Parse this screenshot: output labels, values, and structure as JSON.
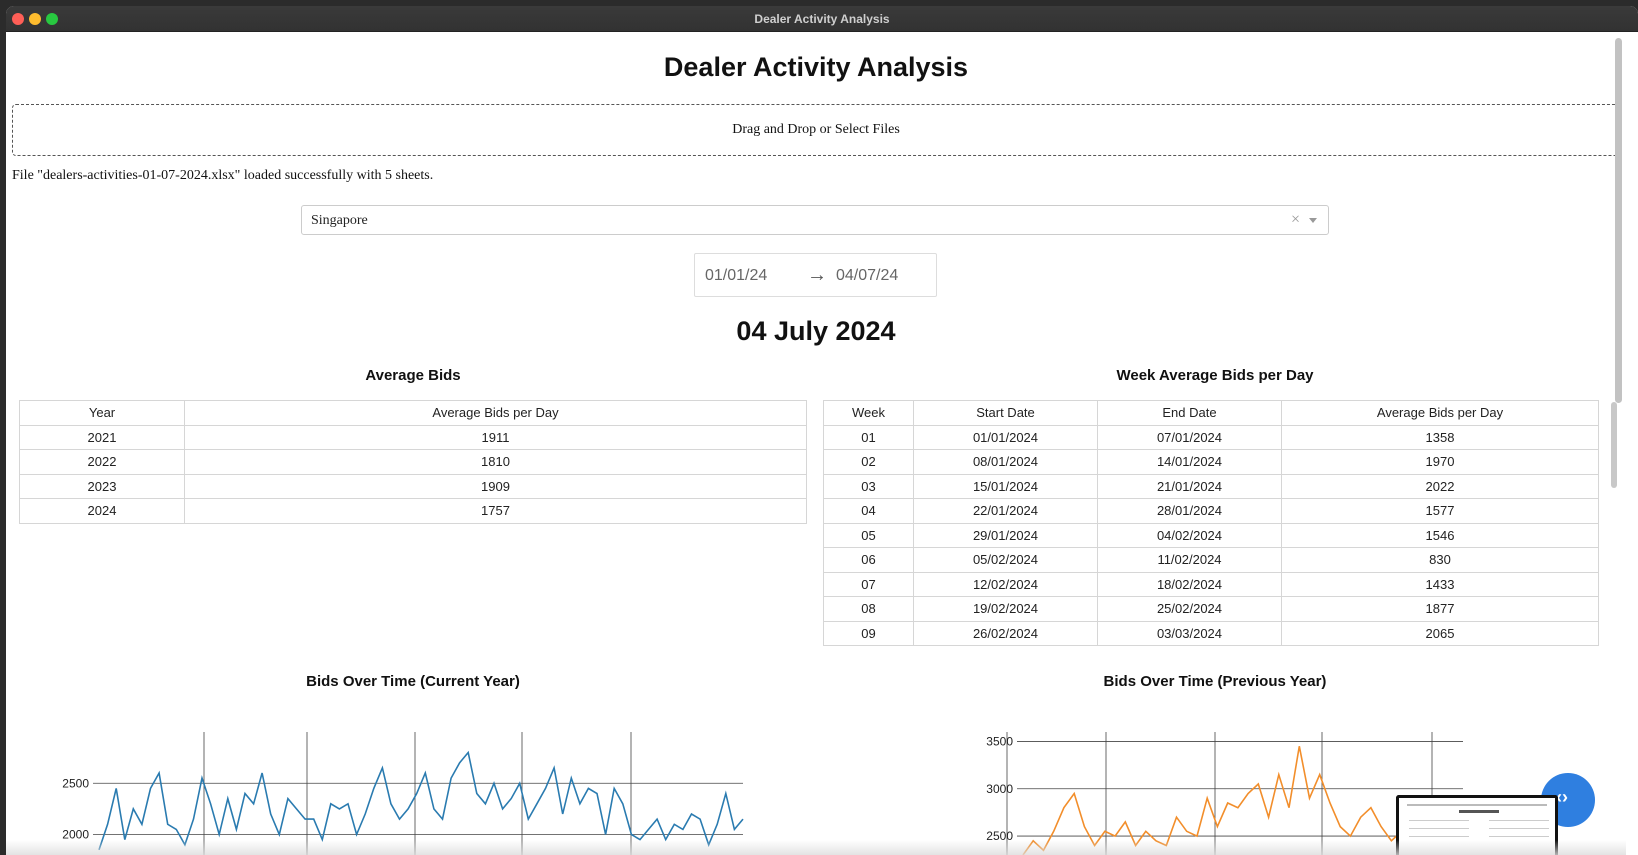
{
  "window": {
    "title": "Dealer Activity Analysis"
  },
  "page": {
    "title": "Dealer Activity Analysis"
  },
  "upload": {
    "label": "Drag and Drop or Select Files"
  },
  "file_message": "File \"dealers-activities-01-07-2024.xlsx\" loaded successfully with 5 sheets.",
  "country_select": {
    "value": "Singapore",
    "clear": "×"
  },
  "date_range": {
    "start": "01/01/24",
    "arrow": "→",
    "end": "04/07/24"
  },
  "selected_date": "04 July 2024",
  "avg_bids": {
    "title": "Average Bids",
    "headers": [
      "Year",
      "Average Bids per Day"
    ],
    "rows": [
      [
        "2021",
        "1911"
      ],
      [
        "2022",
        "1810"
      ],
      [
        "2023",
        "1909"
      ],
      [
        "2024",
        "1757"
      ]
    ]
  },
  "week_avg": {
    "title": "Week Average Bids per Day",
    "headers": [
      "Week",
      "Start Date",
      "End Date",
      "Average Bids per Day"
    ],
    "rows": [
      [
        "01",
        "01/01/2024",
        "07/01/2024",
        "1358"
      ],
      [
        "02",
        "08/01/2024",
        "14/01/2024",
        "1970"
      ],
      [
        "03",
        "15/01/2024",
        "21/01/2024",
        "2022"
      ],
      [
        "04",
        "22/01/2024",
        "28/01/2024",
        "1577"
      ],
      [
        "05",
        "29/01/2024",
        "04/02/2024",
        "1546"
      ],
      [
        "06",
        "05/02/2024",
        "11/02/2024",
        "830"
      ],
      [
        "07",
        "12/02/2024",
        "18/02/2024",
        "1433"
      ],
      [
        "08",
        "19/02/2024",
        "25/02/2024",
        "1877"
      ],
      [
        "09",
        "26/02/2024",
        "03/03/2024",
        "2065"
      ]
    ]
  },
  "chart_current": {
    "title": "Bids Over Time (Current Year)"
  },
  "chart_previous": {
    "title": "Bids Over Time (Previous Year)"
  },
  "chart_data": [
    {
      "type": "line",
      "title": "Bids Over Time (Current Year)",
      "color": "#2a7bb0",
      "yticks": [
        2000,
        2500
      ],
      "ylim": [
        1800,
        3000
      ],
      "values": [
        1850,
        2100,
        2450,
        1950,
        2250,
        2100,
        2450,
        2600,
        2100,
        2050,
        1900,
        2150,
        2550,
        2300,
        2000,
        2350,
        2050,
        2400,
        2300,
        2600,
        2200,
        2000,
        2350,
        2250,
        2150,
        2150,
        1950,
        2300,
        2250,
        2300,
        2000,
        2200,
        2450,
        2650,
        2300,
        2150,
        2250,
        2400,
        2600,
        2250,
        2150,
        2550,
        2700,
        2800,
        2400,
        2300,
        2500,
        2250,
        2350,
        2500,
        2150,
        2300,
        2450,
        2650,
        2200,
        2550,
        2300,
        2450,
        2400,
        2000,
        2450,
        2300,
        2000,
        1950,
        2050,
        2150,
        1950,
        2100,
        2050,
        2200,
        2150,
        1900,
        2100,
        2400,
        2050,
        2150
      ]
    },
    {
      "type": "line",
      "title": "Bids Over Time (Previous Year)",
      "color": "#f28e2b",
      "yticks": [
        2500,
        3000,
        3500
      ],
      "ylim": [
        2300,
        3600
      ],
      "values": [
        2300,
        2450,
        2350,
        2550,
        2800,
        2950,
        2600,
        2400,
        2550,
        2500,
        2650,
        2400,
        2550,
        2450,
        2400,
        2700,
        2550,
        2500,
        2900,
        2600,
        2850,
        2800,
        2950,
        3050,
        2700,
        3150,
        2800,
        3450,
        2900,
        3150,
        2850,
        2600,
        2500,
        2700,
        2800,
        2600,
        2450,
        2550,
        2350,
        2500,
        2450,
        2400,
        2550,
        2450
      ]
    }
  ]
}
